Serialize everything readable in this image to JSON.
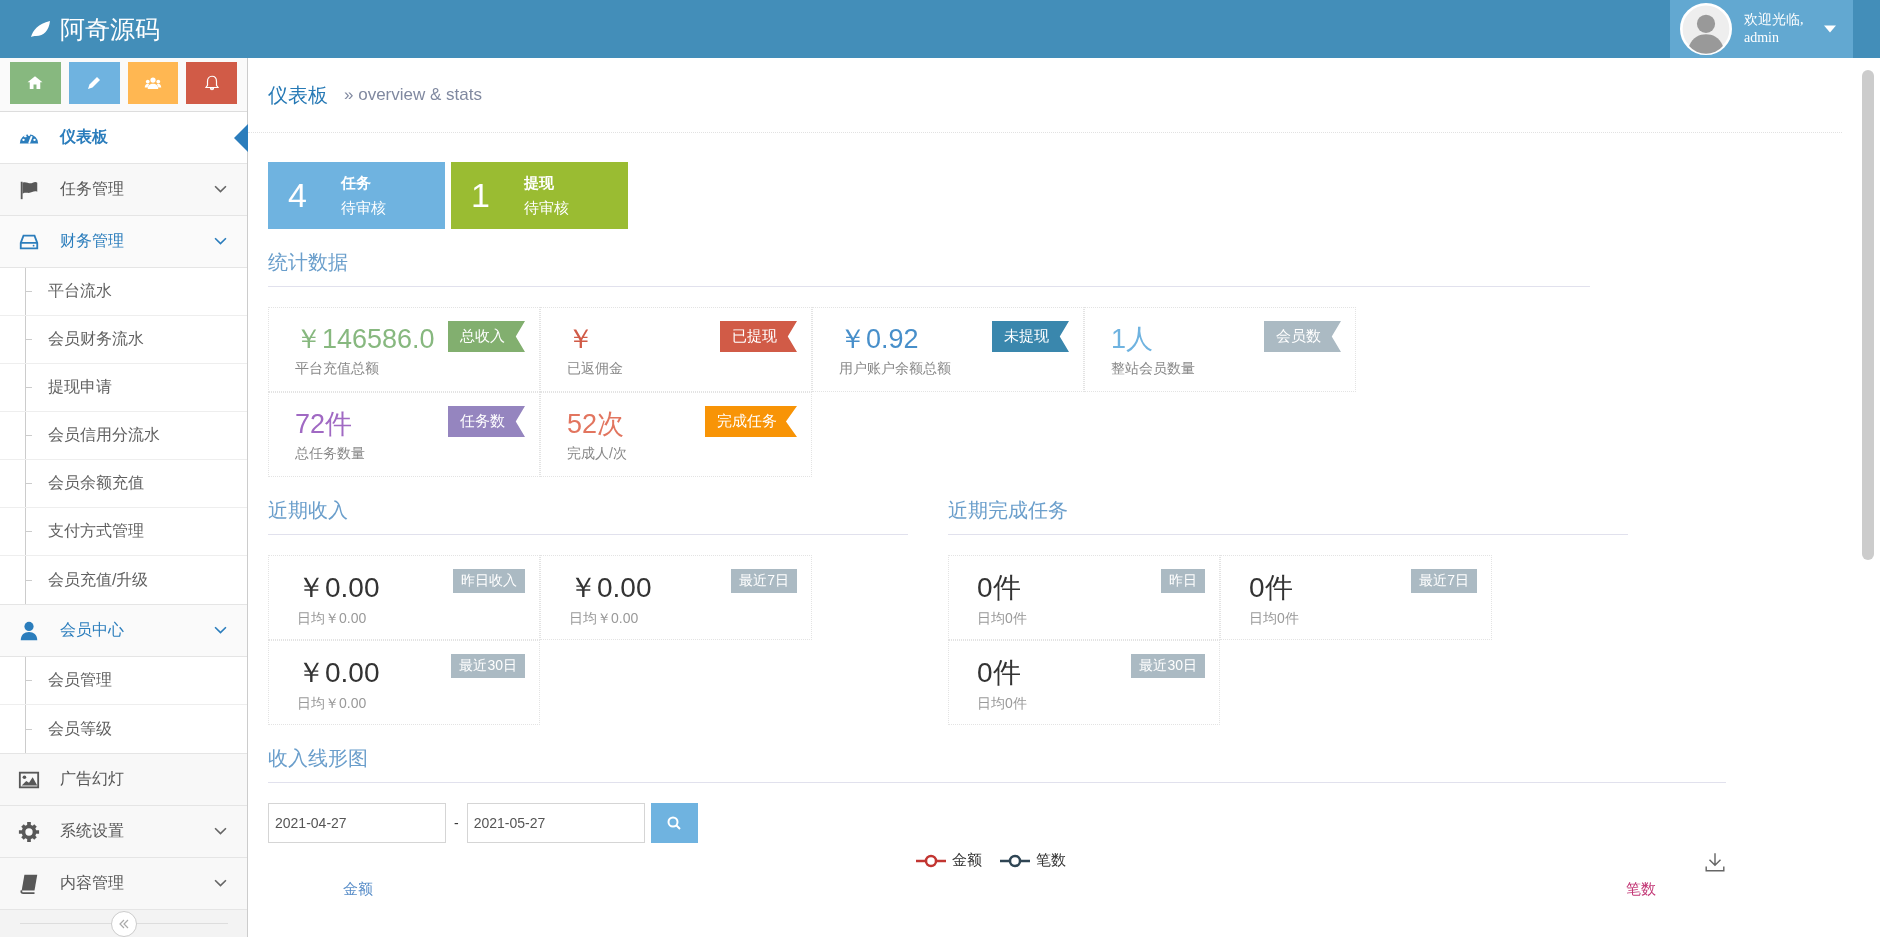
{
  "header": {
    "brand": "阿奇源码",
    "greeting": "欢迎光临,",
    "user": "admin"
  },
  "sidebar": {
    "items": [
      {
        "label": "仪表板",
        "selected": true,
        "expandable": false,
        "expanded": false
      },
      {
        "label": "任务管理",
        "selected": false,
        "expandable": true,
        "expanded": false
      },
      {
        "label": "财务管理",
        "selected": false,
        "expandable": true,
        "expanded": true,
        "children": [
          {
            "label": "平台流水"
          },
          {
            "label": "会员财务流水"
          },
          {
            "label": "提现申请"
          },
          {
            "label": "会员信用分流水"
          },
          {
            "label": "会员余额充值"
          },
          {
            "label": "支付方式管理"
          },
          {
            "label": "会员充值/升级"
          }
        ]
      },
      {
        "label": "会员中心",
        "selected": false,
        "expandable": true,
        "expanded": true,
        "children": [
          {
            "label": "会员管理"
          },
          {
            "label": "会员等级"
          }
        ]
      },
      {
        "label": "广告幻灯",
        "selected": false,
        "expandable": false,
        "expanded": false
      },
      {
        "label": "系统设置",
        "selected": false,
        "expandable": true,
        "expanded": false
      },
      {
        "label": "内容管理",
        "selected": false,
        "expandable": true,
        "expanded": false
      }
    ]
  },
  "breadcrumb": {
    "title": "仪表板",
    "subtitle": "» overview & stats"
  },
  "pending": [
    {
      "count": "4",
      "label": "任务",
      "sub": "待审核",
      "color": "#6fb3e0"
    },
    {
      "count": "1",
      "label": "提现",
      "sub": "待审核",
      "color": "#9abc32"
    }
  ],
  "stats": {
    "title": "统计数据",
    "cards": [
      {
        "value": "￥146586.0",
        "caption": "平台充值总额",
        "badge": {
          "text": "总收入",
          "color": "#82af6f"
        },
        "color": "#87b87f"
      },
      {
        "value": "￥",
        "caption": "已返佣金",
        "badge": {
          "text": "已提现",
          "color": "#d15b47"
        },
        "color": "#d15b47"
      },
      {
        "value": "￥0.92",
        "caption": "用户账户余额总额",
        "badge": {
          "text": "未提现",
          "color": "#3a87ad"
        },
        "color": "#478fca"
      },
      {
        "value": "1人",
        "caption": "整站会员数量",
        "badge": {
          "text": "会员数",
          "color": "#abbac3"
        },
        "color": "#6fb3e0"
      },
      {
        "value": "72件",
        "caption": "总任务数量",
        "badge": {
          "text": "任务数",
          "color": "#9585bf"
        },
        "color": "#a069c3"
      },
      {
        "value": "52次",
        "caption": "完成人/次",
        "badge": {
          "text": "完成任务",
          "color": "#f89406"
        },
        "color": "#e2755f"
      }
    ]
  },
  "recent_income": {
    "title": "近期收入",
    "cards": [
      {
        "value": "￥0.00",
        "caption": "日均￥0.00",
        "badge": "昨日收入"
      },
      {
        "value": "￥0.00",
        "caption": "日均￥0.00",
        "badge": "最近7日"
      },
      {
        "value": "￥0.00",
        "caption": "日均￥0.00",
        "badge": "最近30日"
      }
    ]
  },
  "recent_tasks": {
    "title": "近期完成任务",
    "cards": [
      {
        "value": "0件",
        "caption": "日均0件",
        "badge": "昨日"
      },
      {
        "value": "0件",
        "caption": "日均0件",
        "badge": "最近7日"
      },
      {
        "value": "0件",
        "caption": "日均0件",
        "badge": "最近30日"
      }
    ]
  },
  "income_chart": {
    "title": "收入线形图",
    "date_from": "2021-04-27",
    "separator": "-",
    "date_to": "2021-05-27",
    "legend": [
      {
        "name": "金额",
        "color": "#c23531"
      },
      {
        "name": "笔数",
        "color": "#2f4554"
      }
    ],
    "left_axis": "金额",
    "right_axis": "笔数"
  }
}
